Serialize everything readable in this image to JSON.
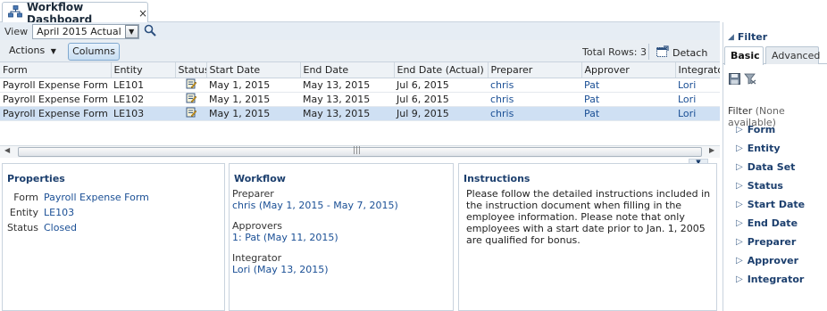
{
  "tab": {
    "title": "Workflow Dashboard",
    "close": "×"
  },
  "viewbar": {
    "label": "View",
    "selected": "April 2015 Actual"
  },
  "toolbar": {
    "actions": "Actions",
    "columns": "Columns",
    "total_rows": "Total Rows: 3",
    "detach": "Detach"
  },
  "grid": {
    "headers": [
      "Form",
      "Entity",
      "Status",
      "Start Date",
      "End Date",
      "End Date (Actual)",
      "Preparer",
      "Approver",
      "Integrator"
    ],
    "rows": [
      [
        "Payroll Expense Form",
        "LE101",
        "",
        "May 1, 2015",
        "May 13, 2015",
        "Jul 6, 2015",
        "chris",
        "Pat",
        "Lori"
      ],
      [
        "Payroll Expense Form",
        "LE102",
        "",
        "May 1, 2015",
        "May 13, 2015",
        "Jul 6, 2015",
        "chris",
        "Pat",
        "Lori"
      ],
      [
        "Payroll Expense Form",
        "LE103",
        "",
        "May 1, 2015",
        "May 13, 2015",
        "Jul 9, 2015",
        "chris",
        "Pat",
        "Lori"
      ]
    ]
  },
  "properties": {
    "title": "Properties",
    "items": [
      {
        "key": "Form",
        "value": "Payroll Expense Form"
      },
      {
        "key": "Entity",
        "value": "LE103"
      },
      {
        "key": "Status",
        "value": "Closed"
      }
    ]
  },
  "workflow": {
    "title": "Workflow",
    "preparer_label": "Preparer",
    "preparer_value": "chris  (May 1, 2015 - May 7, 2015)",
    "approvers_label": "Approvers",
    "approvers_value": "1: Pat  (May 11, 2015)",
    "integrator_label": "Integrator",
    "integrator_value": "Lori  (May 13, 2015)"
  },
  "instructions": {
    "title": "Instructions",
    "text": "Please follow the detailed instructions included in the instruction document when filling in the employee information. Please note that only employees with a start date prior to Jan. 1, 2005 are qualified for bonus."
  },
  "filter": {
    "title": "Filter",
    "tabs": [
      "Basic",
      "Advanced"
    ],
    "info_label": "Filter",
    "info_value": "(None available)",
    "items": [
      "Form",
      "Entity",
      "Data Set",
      "Status",
      "Start Date",
      "End Date",
      "Preparer",
      "Approver",
      "Integrator"
    ]
  },
  "colors": {
    "accent": "#1c3f6e",
    "link": "#1a4f95",
    "selected_row": "#cfe0f3"
  }
}
